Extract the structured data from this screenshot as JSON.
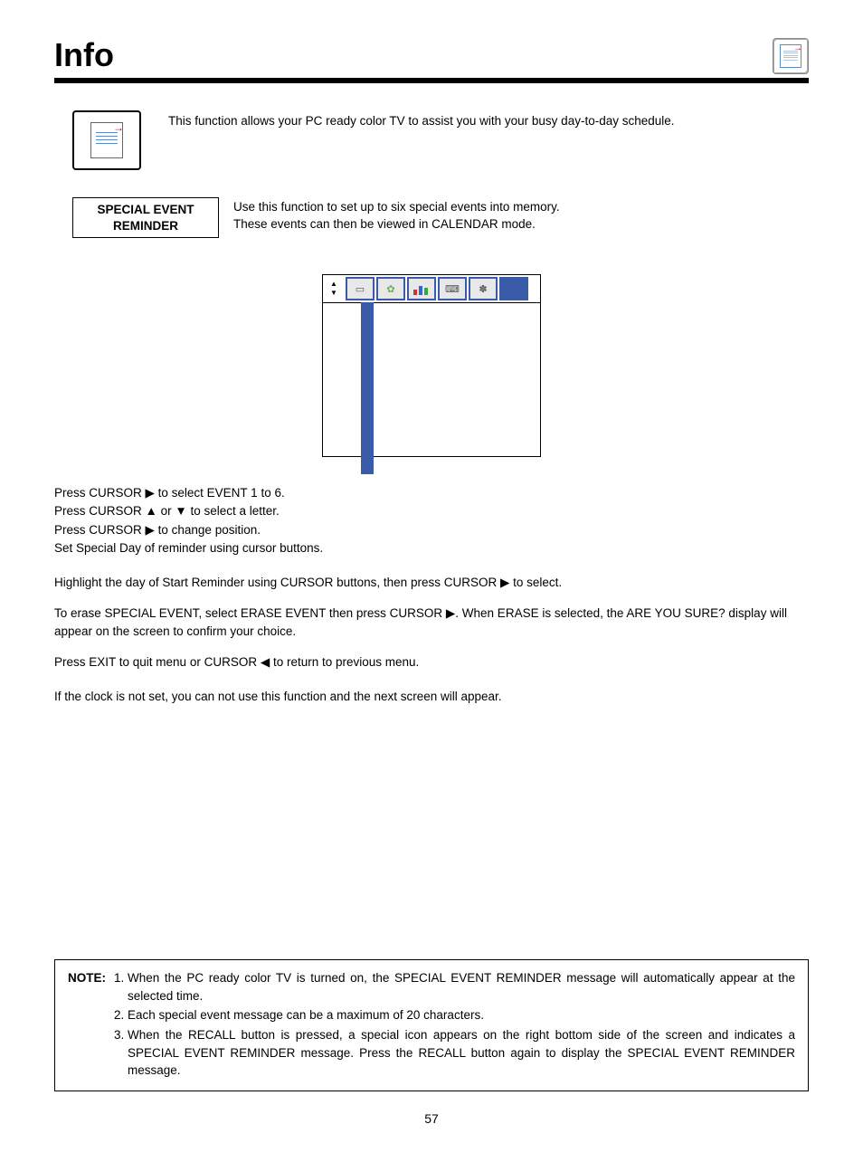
{
  "header": {
    "title": "Info"
  },
  "intro": {
    "text": "This function allows your PC ready color TV to assist you with your busy day-to-day schedule."
  },
  "feature": {
    "label_line1": "SPECIAL EVENT",
    "label_line2": "REMINDER",
    "text_line1": "Use this function to set up to six special events into memory.",
    "text_line2": "These events can then be viewed in CALENDAR mode."
  },
  "instructions": {
    "l1": "Press CURSOR ▶ to select EVENT 1 to 6.",
    "l2": "Press CURSOR ▲ or ▼ to select a letter.",
    "l3": "Press CURSOR ▶ to change position.",
    "l4": "Set Special Day of reminder using cursor buttons.",
    "p2": "Highlight the day of Start Reminder using CURSOR buttons, then press CURSOR ▶ to select.",
    "p3": "To erase SPECIAL EVENT, select ERASE EVENT then press CURSOR ▶. When ERASE is selected, the  ARE YOU SURE? display will appear on the screen to confirm your choice.",
    "p4": "Press EXIT to quit menu or CURSOR ◀ to return to previous menu.",
    "p5": "If the clock is not set, you can not use this function and the next screen will appear."
  },
  "note": {
    "label": "NOTE:",
    "items": [
      "When the PC ready color TV is turned on, the SPECIAL EVENT REMINDER message will automatically appear at the selected time.",
      "Each special event message can be a maximum of 20 characters.",
      "When the RECALL button is pressed, a special icon appears on the right bottom side of the screen and indicates a SPECIAL EVENT REMINDER message. Press the RECALL button again to display the SPECIAL EVENT REMINDER message."
    ]
  },
  "page_number": "57",
  "tv_toolbar": {
    "arrow_up": "▲",
    "arrow_down": "▼"
  }
}
